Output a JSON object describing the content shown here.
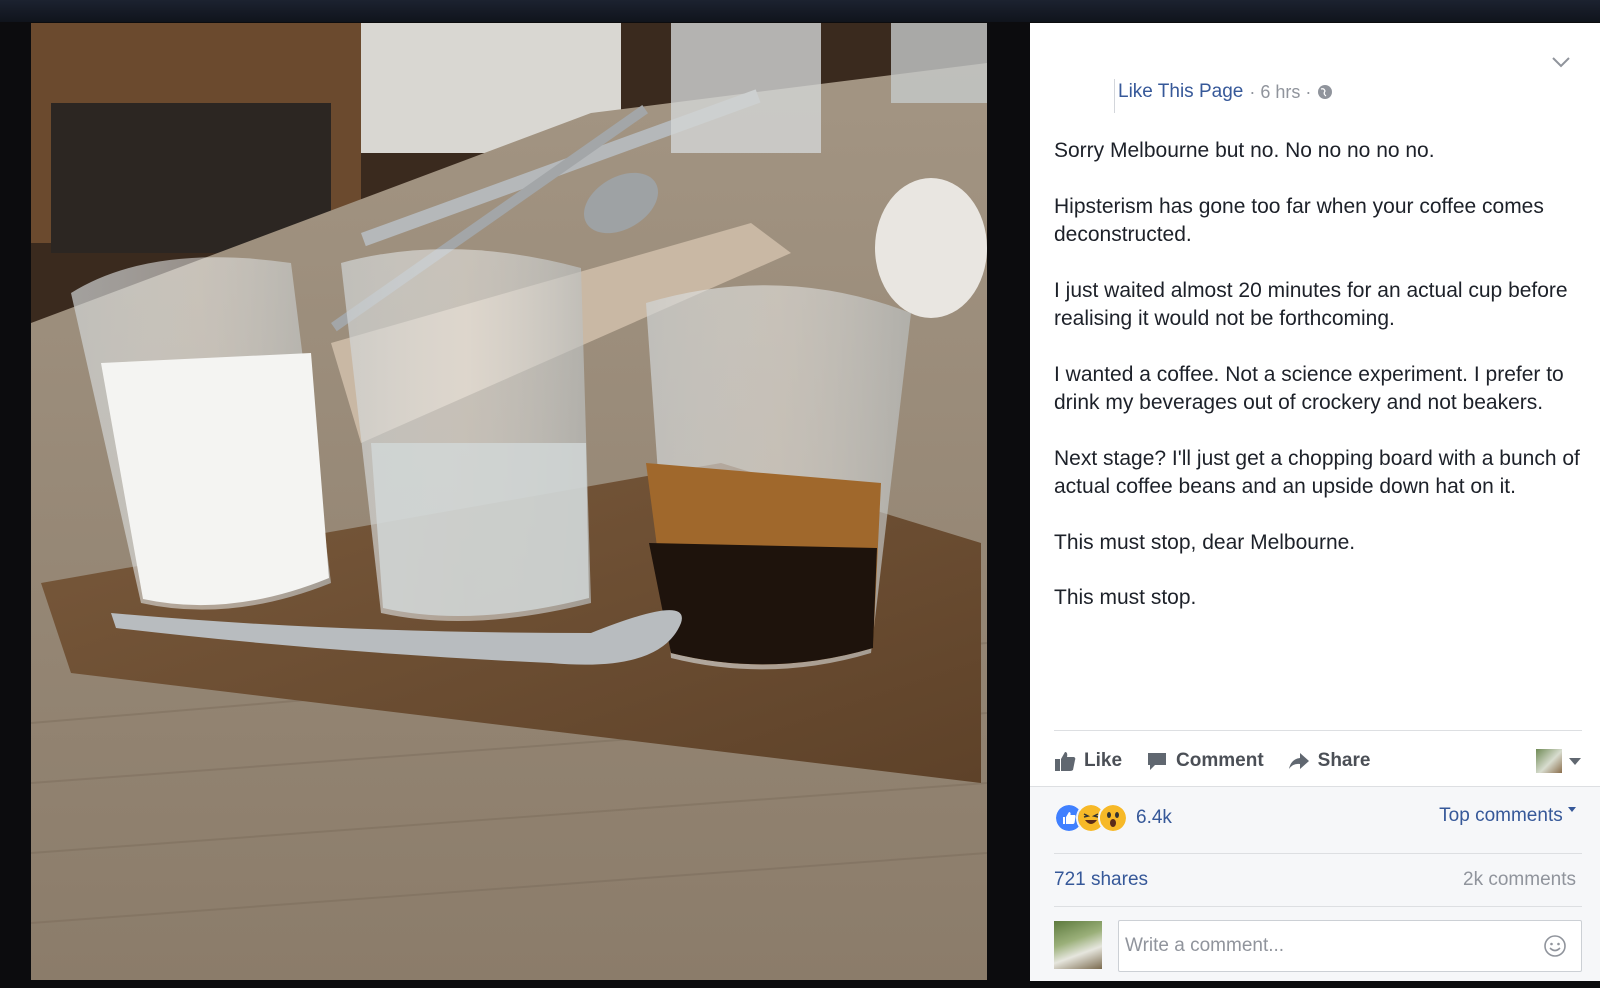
{
  "post": {
    "like_page_link": "Like This Page",
    "timestamp": "· 6 hrs ·",
    "paragraphs": [
      "Sorry Melbourne but no. No no no no no.",
      "Hipsterism has gone too far when your coffee comes deconstructed.",
      "I just waited almost 20 minutes for an actual cup before realising it would not be forthcoming.",
      "I wanted a coffee. Not a science experiment. I prefer to drink my beverages out of crockery and not beakers.",
      "Next stage? I'll just get a chopping board with a bunch of actual coffee beans and an upside down hat on it.",
      "This must stop, dear Melbourne.",
      "This must stop."
    ]
  },
  "actions": {
    "like": "Like",
    "comment": "Comment",
    "share": "Share"
  },
  "stats": {
    "reactions_count": "6.4k",
    "top_comments": "Top comments",
    "shares": "721 shares",
    "comments": "2k comments"
  },
  "comment_box": {
    "placeholder": "Write a comment..."
  },
  "colors": {
    "link": "#365899",
    "like_blue": "#4080ff",
    "haha_yellow": "#f7b928",
    "panel_bg": "#ffffff"
  },
  "icons": [
    "chevron-down-icon",
    "globe-icon",
    "like-icon",
    "comment-icon",
    "share-icon",
    "smiley-icon"
  ]
}
